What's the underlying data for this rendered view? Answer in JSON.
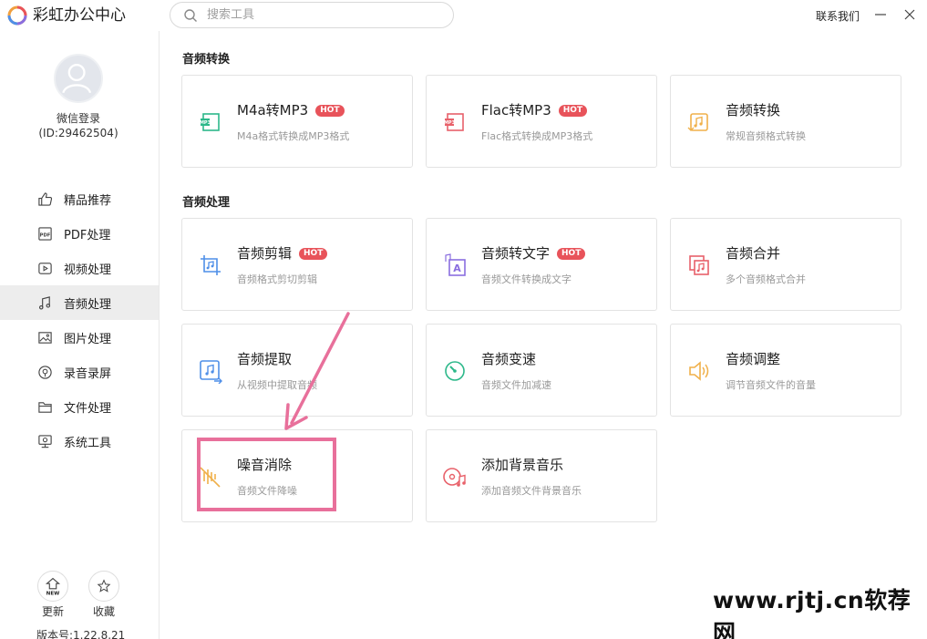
{
  "app": {
    "title": "彩虹办公中心"
  },
  "search": {
    "placeholder": "搜索工具"
  },
  "header": {
    "contact": "联系我们"
  },
  "user": {
    "name": "微信登录",
    "id": "(ID:29462504)"
  },
  "nav": [
    {
      "label": "精品推荐",
      "icon": "thumbs-up-icon"
    },
    {
      "label": "PDF处理",
      "icon": "pdf-icon"
    },
    {
      "label": "视频处理",
      "icon": "video-icon"
    },
    {
      "label": "音频处理",
      "icon": "music-note-icon",
      "active": true
    },
    {
      "label": "图片处理",
      "icon": "image-icon"
    },
    {
      "label": "录音录屏",
      "icon": "record-icon"
    },
    {
      "label": "文件处理",
      "icon": "folder-icon"
    },
    {
      "label": "系统工具",
      "icon": "monitor-icon"
    }
  ],
  "bottom": {
    "update": "更新",
    "update_badge": "NEW",
    "favorite": "收藏",
    "version": "版本号:1.22.8.21"
  },
  "sections": [
    {
      "title": "音频转换"
    },
    {
      "title": "音频处理"
    }
  ],
  "cards": [
    {
      "title": "M4a转MP3",
      "hot": "HOT",
      "desc": "M4a格式转换成MP3格式",
      "icon_text": "MP3",
      "color": "#2db88a"
    },
    {
      "title": "Flac转MP3",
      "hot": "HOT",
      "desc": "Flac格式转换成MP3格式",
      "icon_text": "MP3",
      "color": "#e8616a"
    },
    {
      "title": "音频转换",
      "desc": "常规音频格式转换",
      "color": "#f0b04a"
    },
    {
      "title": "音频剪辑",
      "hot": "HOT",
      "desc": "音频格式剪切剪辑",
      "color": "#4f8fe8"
    },
    {
      "title": "音频转文字",
      "hot": "HOT",
      "desc": "音频文件转换成文字",
      "icon_text": "A",
      "color": "#8a6ee0"
    },
    {
      "title": "音频合并",
      "desc": "多个音频格式合并",
      "color": "#e8616a"
    },
    {
      "title": "音频提取",
      "desc": "从视频中提取音频",
      "color": "#4f8fe8"
    },
    {
      "title": "音频变速",
      "desc": "音频文件加减速",
      "color": "#2db88a"
    },
    {
      "title": "音频调整",
      "desc": "调节音频文件的音量",
      "color": "#f0b04a"
    },
    {
      "title": "噪音消除",
      "desc": "音频文件降噪",
      "color": "#f0b04a"
    },
    {
      "title": "添加背景音乐",
      "desc": "添加音频文件背景音乐",
      "color": "#e8616a"
    }
  ],
  "watermark": "www.rjtj.cn软荐网",
  "colors": {
    "accent_hot": "#e8535a",
    "highlight": "#e8709b",
    "active_nav": "#ededed"
  }
}
